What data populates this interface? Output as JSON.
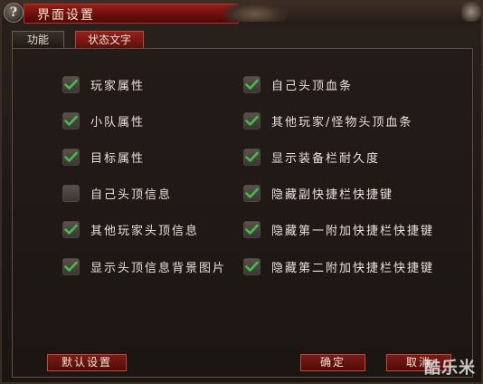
{
  "window": {
    "title": "界面设置",
    "help_label": "?"
  },
  "tabs": [
    {
      "label": "功能",
      "active": false
    },
    {
      "label": "状态文字",
      "active": true
    }
  ],
  "options_left": [
    {
      "label": "玩家属性",
      "checked": true
    },
    {
      "label": "小队属性",
      "checked": true
    },
    {
      "label": "目标属性",
      "checked": true
    },
    {
      "label": "自己头顶信息",
      "checked": false
    },
    {
      "label": "其他玩家头顶信息",
      "checked": true
    },
    {
      "label": "显示头顶信息背景图片",
      "checked": true
    }
  ],
  "options_right": [
    {
      "label": "自己头顶血条",
      "checked": true
    },
    {
      "label": "其他玩家/怪物头顶血条",
      "checked": true
    },
    {
      "label": "显示装备栏耐久度",
      "checked": true
    },
    {
      "label": "隐藏副快捷栏快捷键",
      "checked": true
    },
    {
      "label": "隐藏第一附加快捷栏快捷键",
      "checked": true
    },
    {
      "label": "隐藏第二附加快捷栏快捷键",
      "checked": true
    }
  ],
  "buttons": {
    "default_label": "默认设置",
    "ok_label": "确定",
    "cancel_label": "取消"
  },
  "watermark": "酷乐米",
  "colors": {
    "accent_red": "#7c1a14",
    "check_green": "#3fbf4a",
    "text": "#eae2d6"
  }
}
